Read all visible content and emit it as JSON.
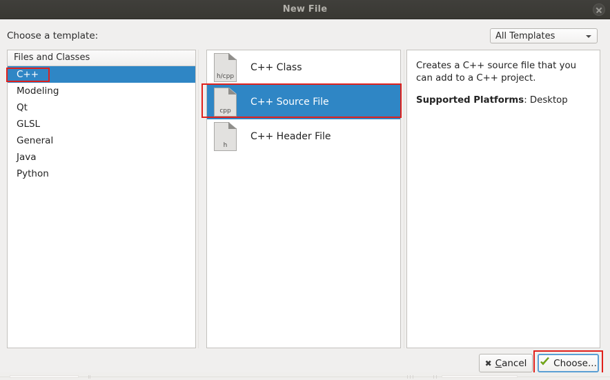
{
  "window": {
    "title": "New File",
    "close_icon": "close-icon"
  },
  "toolbar": {
    "prompt_label": "Choose a template:",
    "filter_dropdown": {
      "selected": "All Templates",
      "arrow_icon": "chevron-down-icon"
    }
  },
  "categories": {
    "header": "Files and Classes",
    "items": [
      {
        "label": "C++",
        "selected": true
      },
      {
        "label": "Modeling",
        "selected": false
      },
      {
        "label": "Qt",
        "selected": false
      },
      {
        "label": "GLSL",
        "selected": false
      },
      {
        "label": "General",
        "selected": false
      },
      {
        "label": "Java",
        "selected": false
      },
      {
        "label": "Python",
        "selected": false
      }
    ]
  },
  "templates": {
    "items": [
      {
        "label": "C++ Class",
        "icon_ext": "h/cpp",
        "icon": "file-document-icon",
        "selected": false
      },
      {
        "label": "C++ Source File",
        "icon_ext": "cpp",
        "icon": "file-document-icon",
        "selected": true
      },
      {
        "label": "C++ Header File",
        "icon_ext": "h",
        "icon": "file-document-icon",
        "selected": false
      }
    ]
  },
  "details": {
    "description": "Creates a C++ source file that you can add to a C++ project.",
    "platforms_key": "Supported Platforms",
    "platforms_sep": ": ",
    "platforms_value": "Desktop"
  },
  "buttons": {
    "cancel": {
      "label_pre": "",
      "label_mnemonic": "C",
      "label_post": "ancel",
      "icon": "cross-icon"
    },
    "choose": {
      "label": "Choose...",
      "icon": "green-check-icon"
    }
  },
  "colors": {
    "selection_blue": "#2f86c5",
    "annotation_red": "#e0201b",
    "titlebar": "#3c3b37",
    "dialog_bg": "#f0efee",
    "focus_blue": "#5a9fd4",
    "check_green": "#7ab317"
  },
  "annotations": [
    {
      "name": "annotation-cpp-category",
      "target": "C++"
    },
    {
      "name": "annotation-cpp-source-file",
      "target": "C++ Source File"
    },
    {
      "name": "annotation-choose-button",
      "target": "Choose..."
    }
  ]
}
